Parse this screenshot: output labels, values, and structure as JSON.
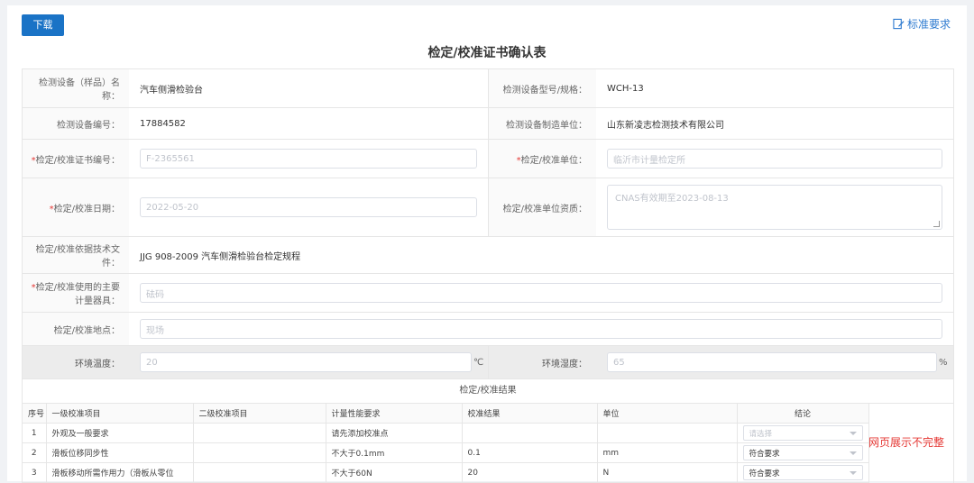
{
  "toolbar": {
    "download_label": "下载",
    "standard_link": "标准要求"
  },
  "title": "检定/校准证书确认表",
  "fields": {
    "device_name_label": "检测设备（样品）名称：",
    "device_name_value": "汽车侧滑检验台",
    "device_model_label": "检测设备型号/规格：",
    "device_model_value": "WCH-13",
    "device_no_label": "检测设备编号：",
    "device_no_value": "17884582",
    "manufacturer_label": "检测设备制造单位：",
    "manufacturer_value": "山东新凌志检测技术有限公司",
    "cert_no_label": "检定/校准证书编号：",
    "cert_no_value": "F-2365561",
    "calib_unit_label": "检定/校准单位：",
    "calib_unit_value": "临沂市计量检定所",
    "calib_date_label": "检定/校准日期：",
    "calib_date_value": "2022-05-20",
    "calib_qual_label": "检定/校准单位资质：",
    "calib_qual_value": "CNAS有效期至2023-08-13",
    "basis_label": "检定/校准依据技术文件：",
    "basis_value": "JJG 908-2009 汽车侧滑检验台检定规程",
    "instrument_label": "检定/校准使用的主要计量器具：",
    "instrument_value": "砝码",
    "location_label": "检定/校准地点：",
    "location_value": "现场",
    "temp_label": "环境温度：",
    "temp_value": "20",
    "temp_unit": "℃",
    "humidity_label": "环境湿度：",
    "humidity_value": "65",
    "humidity_unit": "%"
  },
  "results": {
    "section_title": "检定/校准结果",
    "headers": [
      "序号",
      "一级校准项目",
      "二级校准项目",
      "计量性能要求",
      "校准结果",
      "单位",
      "结论"
    ],
    "rows": [
      {
        "no": "1",
        "item1": "外观及一般要求",
        "item2": "",
        "req": "请先添加校准点",
        "result": "",
        "unit": "",
        "conclusion": "请选择",
        "placeholder": true
      },
      {
        "no": "2",
        "item1": "滑板位移同步性",
        "item2": "",
        "req": "不大于0.1mm",
        "result": "0.1",
        "unit": "mm",
        "conclusion": "符合要求",
        "placeholder": false
      },
      {
        "no": "3",
        "item1": "滑板移动所需作用力（滑板从零位",
        "item2": "",
        "req": "不大于60N",
        "result": "20",
        "unit": "N",
        "conclusion": "符合要求",
        "placeholder": false
      }
    ]
  },
  "notice": "网页展示不完整"
}
